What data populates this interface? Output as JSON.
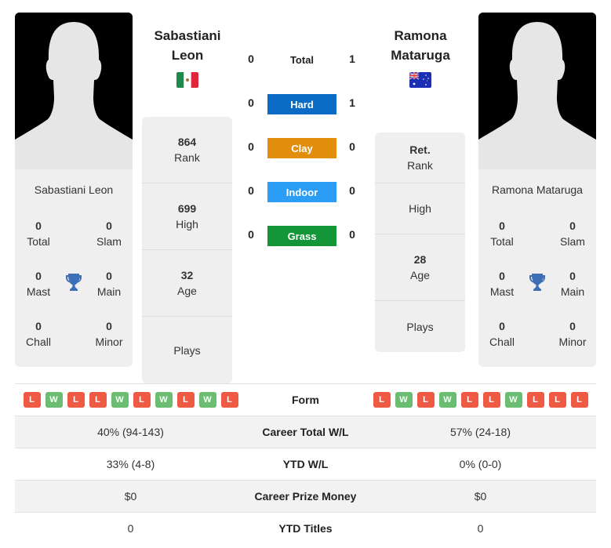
{
  "players": {
    "left": {
      "name": "Sabastiani Leon",
      "title_line1": "Sabastiani",
      "title_line2": "Leon",
      "flag": "mexico-flag",
      "titles": {
        "total": {
          "value": "0",
          "label": "Total"
        },
        "slam": {
          "value": "0",
          "label": "Slam"
        },
        "mast": {
          "value": "0",
          "label": "Mast"
        },
        "main": {
          "value": "0",
          "label": "Main"
        },
        "chall": {
          "value": "0",
          "label": "Chall"
        },
        "minor": {
          "value": "0",
          "label": "Minor"
        }
      },
      "info": {
        "rank": {
          "value": "864",
          "label": "Rank"
        },
        "high": {
          "value": "699",
          "label": "High"
        },
        "age": {
          "value": "32",
          "label": "Age"
        },
        "plays": {
          "value": "",
          "label": "Plays"
        }
      },
      "form": [
        "L",
        "W",
        "L",
        "L",
        "W",
        "L",
        "W",
        "L",
        "W",
        "L"
      ]
    },
    "right": {
      "name": "Ramona Mataruga",
      "title_line1": "Ramona",
      "title_line2": "Mataruga",
      "flag": "australia-flag",
      "titles": {
        "total": {
          "value": "0",
          "label": "Total"
        },
        "slam": {
          "value": "0",
          "label": "Slam"
        },
        "mast": {
          "value": "0",
          "label": "Mast"
        },
        "main": {
          "value": "0",
          "label": "Main"
        },
        "chall": {
          "value": "0",
          "label": "Chall"
        },
        "minor": {
          "value": "0",
          "label": "Minor"
        }
      },
      "info": {
        "rank": {
          "value": "Ret.",
          "label": "Rank"
        },
        "high": {
          "value": "",
          "label": "High"
        },
        "age": {
          "value": "28",
          "label": "Age"
        },
        "plays": {
          "value": "",
          "label": "Plays"
        }
      },
      "form": [
        "L",
        "W",
        "L",
        "W",
        "L",
        "L",
        "W",
        "L",
        "L",
        "L"
      ]
    }
  },
  "h2h": [
    {
      "label": "Total",
      "left": "0",
      "right": "1",
      "color": null
    },
    {
      "label": "Hard",
      "left": "0",
      "right": "1",
      "color": "#0a6cc4"
    },
    {
      "label": "Clay",
      "left": "0",
      "right": "0",
      "color": "#e08e0b"
    },
    {
      "label": "Indoor",
      "left": "0",
      "right": "0",
      "color": "#2b9df4"
    },
    {
      "label": "Grass",
      "left": "0",
      "right": "0",
      "color": "#149538"
    }
  ],
  "comparison": {
    "form_label": "Form",
    "rows": [
      {
        "label": "Career Total W/L",
        "left": "40% (94-143)",
        "right": "57% (24-18)"
      },
      {
        "label": "YTD W/L",
        "left": "33% (4-8)",
        "right": "0% (0-0)"
      },
      {
        "label": "Career Prize Money",
        "left": "$0",
        "right": "$0"
      },
      {
        "label": "YTD Titles",
        "left": "0",
        "right": "0"
      }
    ]
  },
  "colors": {
    "loss": "#ee5a44",
    "win": "#6bbd72",
    "trophy": "#3d6fb6"
  }
}
